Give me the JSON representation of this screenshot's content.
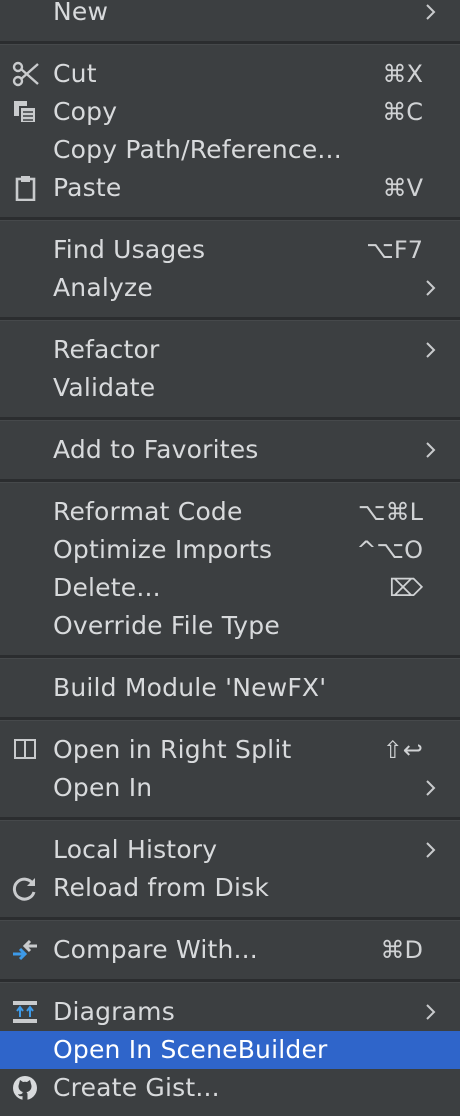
{
  "menu": {
    "items": [
      {
        "id": "new",
        "label": "New",
        "submenu": true
      },
      {
        "id": "cut",
        "label": "Cut",
        "shortcut": "⌘X",
        "icon": "scissors-icon"
      },
      {
        "id": "copy",
        "label": "Copy",
        "shortcut": "⌘C",
        "icon": "copy-icon"
      },
      {
        "id": "copy-path",
        "label": "Copy Path/Reference..."
      },
      {
        "id": "paste",
        "label": "Paste",
        "shortcut": "⌘V",
        "icon": "clipboard-icon"
      },
      {
        "id": "find-usages",
        "label": "Find Usages",
        "shortcut": "⌥F7"
      },
      {
        "id": "analyze",
        "label": "Analyze",
        "submenu": true
      },
      {
        "id": "refactor",
        "label": "Refactor",
        "submenu": true
      },
      {
        "id": "validate",
        "label": "Validate"
      },
      {
        "id": "add-to-favorites",
        "label": "Add to Favorites",
        "submenu": true
      },
      {
        "id": "reformat-code",
        "label": "Reformat Code",
        "shortcut": "⌥⌘L"
      },
      {
        "id": "optimize-imports",
        "label": "Optimize Imports",
        "shortcut": "^⌥O"
      },
      {
        "id": "delete",
        "label": "Delete...",
        "shortcut": "⌦"
      },
      {
        "id": "override-file-type",
        "label": "Override File Type"
      },
      {
        "id": "build-module",
        "label": "Build Module 'NewFX'"
      },
      {
        "id": "open-right-split",
        "label": "Open in Right Split",
        "shortcut": "⇧↩",
        "icon": "split-icon"
      },
      {
        "id": "open-in",
        "label": "Open In",
        "submenu": true
      },
      {
        "id": "local-history",
        "label": "Local History",
        "submenu": true
      },
      {
        "id": "reload-from-disk",
        "label": "Reload from Disk",
        "icon": "reload-icon"
      },
      {
        "id": "compare-with",
        "label": "Compare With...",
        "shortcut": "⌘D",
        "icon": "compare-icon"
      },
      {
        "id": "diagrams",
        "label": "Diagrams",
        "submenu": true,
        "icon": "diagram-icon"
      },
      {
        "id": "open-scenebuilder",
        "label": "Open In SceneBuilder",
        "selected": true
      },
      {
        "id": "create-gist",
        "label": "Create Gist...",
        "icon": "github-icon"
      }
    ]
  },
  "colors": {
    "background": "#3c3f41",
    "selection": "#2f65ca",
    "text": "#d8dadc",
    "accent_blue": "#3d9ae8"
  }
}
